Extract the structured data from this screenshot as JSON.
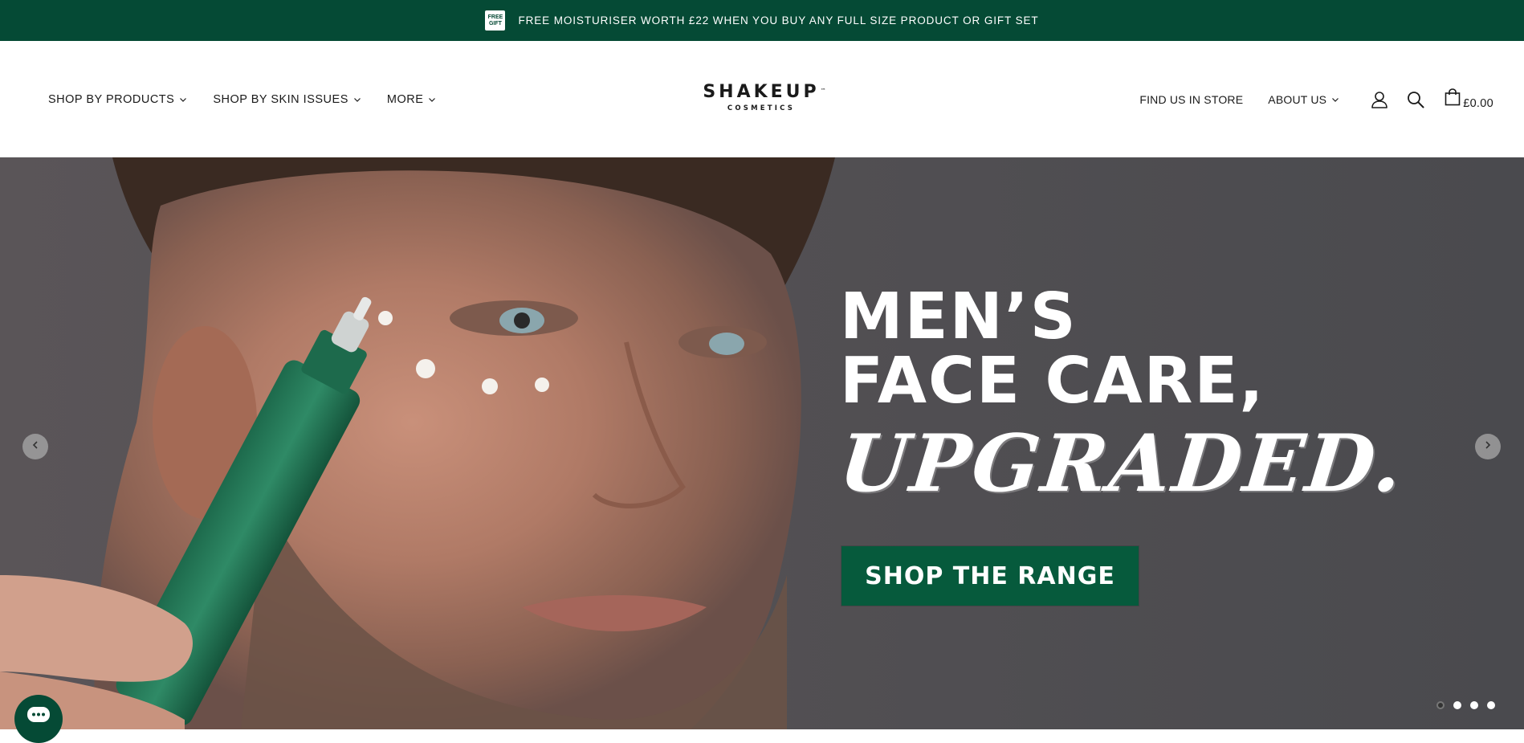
{
  "announcement": {
    "badge_text": "FREE GIFT",
    "text": "FREE MOISTURISER WORTH £22 WHEN YOU BUY ANY FULL SIZE PRODUCT OR GIFT SET"
  },
  "header": {
    "nav_left": [
      {
        "label": "SHOP BY PRODUCTS"
      },
      {
        "label": "SHOP BY SKIN ISSUES"
      },
      {
        "label": "MORE"
      }
    ],
    "logo": {
      "main": "SHAKEUP",
      "sub": "COSMETICS"
    },
    "nav_right": {
      "find_store": "FIND US IN STORE",
      "about": "ABOUT US"
    },
    "icons": [
      "account-icon",
      "search-icon",
      "cart-icon"
    ],
    "cart_total": "£0.00"
  },
  "hero": {
    "headline_line1": "MEN’S",
    "headline_line2": "FACE CARE,",
    "headline_line3": "UPGRADED.",
    "cta_label": "SHOP THE RANGE",
    "slide_count": 4,
    "active_slide": 1
  },
  "colors": {
    "brand_green": "#054a35",
    "cta_green": "#065a3c"
  }
}
